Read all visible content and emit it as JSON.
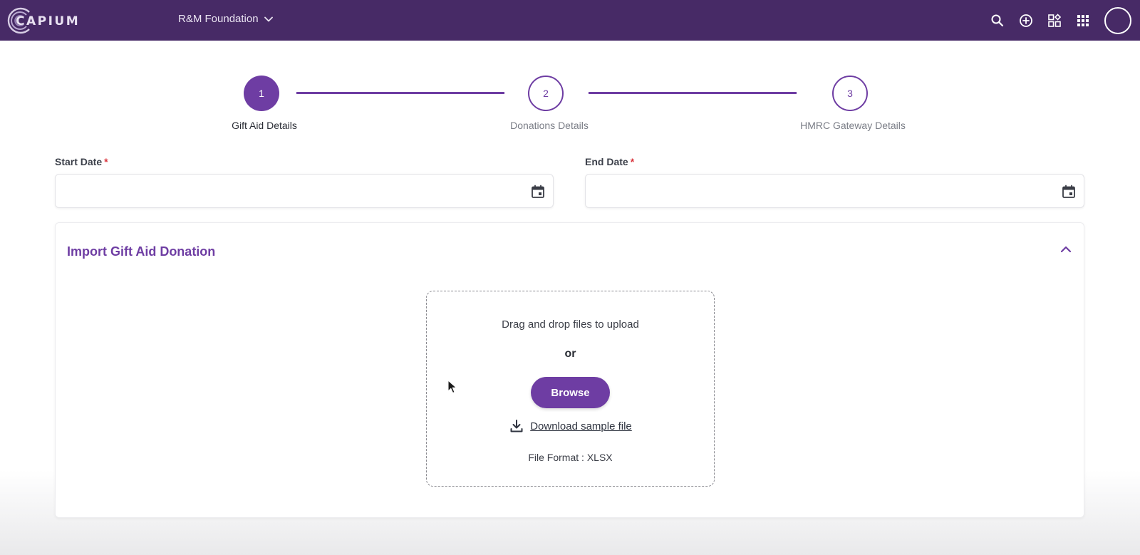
{
  "header": {
    "logo_text": "CAPIUM",
    "organization": "R&M Foundation",
    "icons": [
      "search-icon",
      "add-circle-icon",
      "widgets-icon",
      "apps-grid-icon",
      "avatar"
    ]
  },
  "stepper": {
    "steps": [
      {
        "number": "1",
        "label": "Gift Aid Details",
        "state": "active"
      },
      {
        "number": "2",
        "label": "Donations Details",
        "state": "todo"
      },
      {
        "number": "3",
        "label": "HMRC Gateway Details",
        "state": "todo"
      }
    ]
  },
  "form": {
    "start_date": {
      "label": "Start Date",
      "required_mark": "*",
      "value": ""
    },
    "end_date": {
      "label": "End Date",
      "required_mark": "*",
      "value": ""
    }
  },
  "import_panel": {
    "title": "Import Gift Aid Donation",
    "dropzone_text": "Drag and drop files to upload",
    "or_text": "or",
    "browse_label": "Browse",
    "download_label": "Download sample file",
    "file_format": "File Format : XLSX"
  },
  "colors": {
    "header_bg": "#472a66",
    "accent": "#6e3da3",
    "required": "#d9363e"
  }
}
